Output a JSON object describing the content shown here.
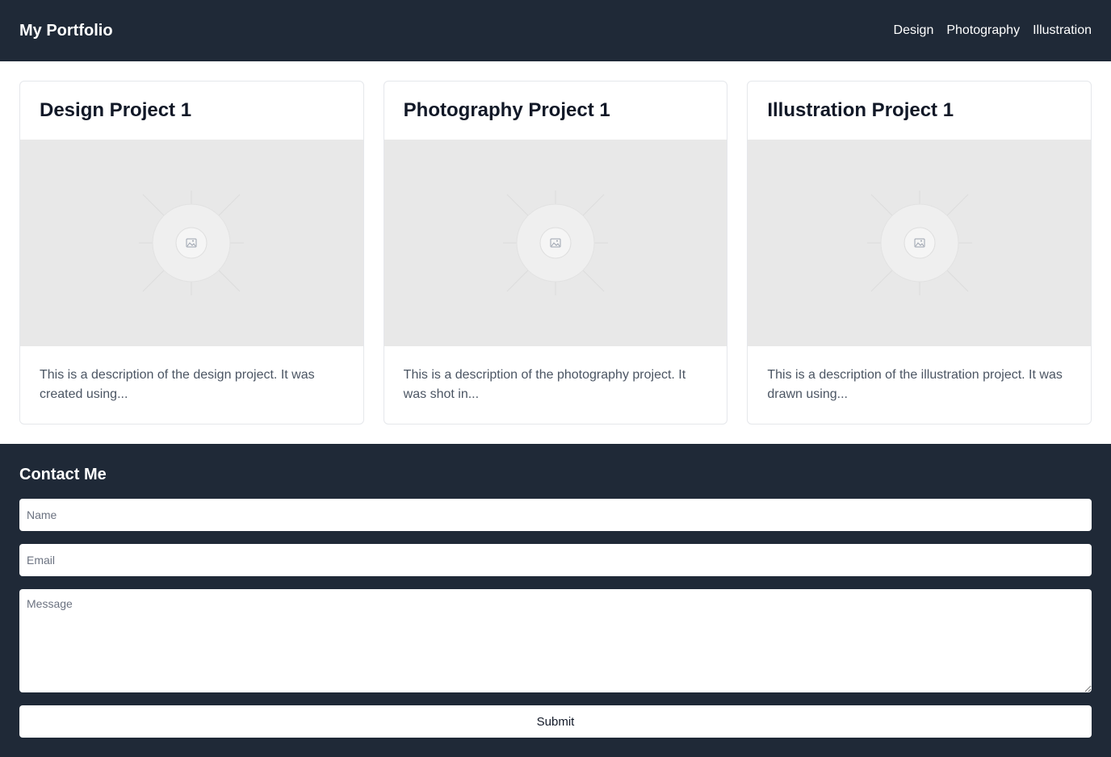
{
  "header": {
    "brand": "My Portfolio",
    "nav": [
      "Design",
      "Photography",
      "Illustration"
    ]
  },
  "projects": [
    {
      "title": "Design Project 1",
      "image_icon": "image-placeholder-icon",
      "description": "This is a description of the design project. It was created using..."
    },
    {
      "title": "Photography Project 1",
      "image_icon": "image-placeholder-icon",
      "description": "This is a description of the photography project. It was shot in..."
    },
    {
      "title": "Illustration Project 1",
      "image_icon": "image-placeholder-icon",
      "description": "This is a description of the illustration project. It was drawn using..."
    }
  ],
  "contact": {
    "title": "Contact Me",
    "name_placeholder": "Name",
    "email_placeholder": "Email",
    "message_placeholder": "Message",
    "submit_label": "Submit"
  },
  "colors": {
    "header_bg": "#1f2937",
    "image_bg": "#e8e8e8"
  }
}
